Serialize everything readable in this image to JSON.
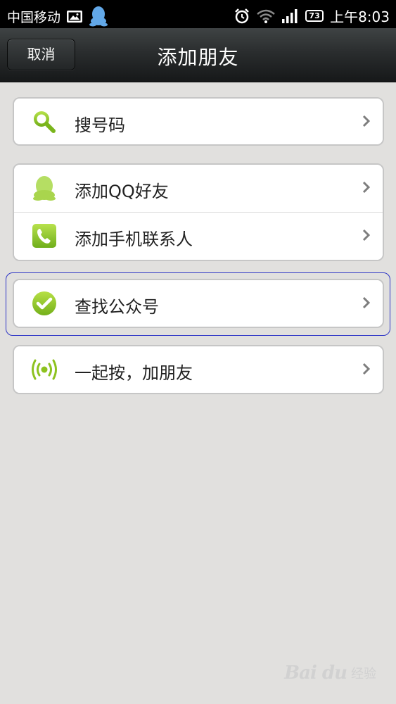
{
  "status_bar": {
    "carrier": "中国移动",
    "battery": "73",
    "time": "上午8:03",
    "icons": [
      "image-icon",
      "qq-icon",
      "alarm-icon",
      "wifi-icon",
      "signal-icon",
      "battery-icon"
    ]
  },
  "nav": {
    "cancel_label": "取消",
    "title": "添加朋友"
  },
  "groups": [
    {
      "items": [
        {
          "label": "搜号码",
          "icon": "search-icon"
        }
      ]
    },
    {
      "items": [
        {
          "label": "添加QQ好友",
          "icon": "qq-penguin-icon"
        },
        {
          "label": "添加手机联系人",
          "icon": "phone-icon"
        }
      ]
    },
    {
      "items": [
        {
          "label": "查找公众号",
          "icon": "check-circle-icon"
        }
      ]
    },
    {
      "items": [
        {
          "label": "一起按，加朋友",
          "icon": "radar-icon"
        }
      ]
    }
  ],
  "colors": {
    "background": "#e1e0de",
    "nav_dark": "#24272a",
    "icon_green": "#8dc21f",
    "focus_blue": "#2e35c6"
  },
  "watermark": {
    "logo": "Bai du",
    "text": "经验"
  }
}
